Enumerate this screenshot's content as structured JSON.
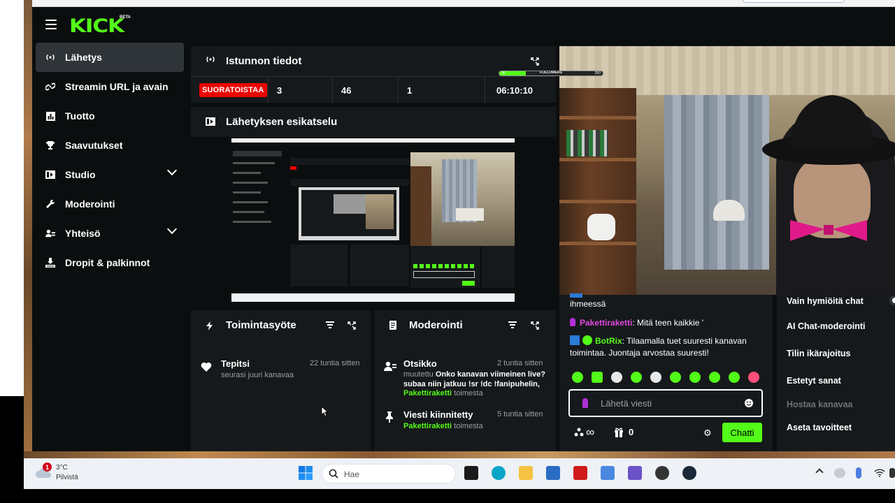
{
  "app": {
    "logo": "KICK",
    "logo_badge": "BETA"
  },
  "sidebar": {
    "items": [
      {
        "label": "Lähetys",
        "icon": "broadcast-icon"
      },
      {
        "label": "Streamin URL ja avain",
        "icon": "link-icon"
      },
      {
        "label": "Tuotto",
        "icon": "chart-icon"
      },
      {
        "label": "Saavutukset",
        "icon": "trophy-icon"
      },
      {
        "label": "Studio",
        "icon": "studio-icon"
      },
      {
        "label": "Moderointi",
        "icon": "wrench-icon"
      },
      {
        "label": "Yhteisö",
        "icon": "community-icon"
      },
      {
        "label": "Dropit & palkinnot",
        "icon": "drops-icon"
      }
    ]
  },
  "session": {
    "title": "Istunnon tiedot",
    "live_badge": "SUORATOISTAA",
    "stat_1": "3",
    "stat_2": "46",
    "stat_3": "1",
    "duration": "06:10:10"
  },
  "preview": {
    "title": "Lähetyksen esikatselu"
  },
  "follow_goal": {
    "label": "FOLLOWERS",
    "current": "66",
    "target": "250",
    "progress": 0.26
  },
  "activity": {
    "title": "Toimintasyöte",
    "items": [
      {
        "name": "Tepitsi",
        "text": "seurasi juuri kanavaa",
        "time": "22 tuntia sitten"
      }
    ]
  },
  "moderation": {
    "title": "Moderointi",
    "items": [
      {
        "title": "Otsikko",
        "time": "2 tuntia sitten",
        "prefix": "muutettu",
        "message": "Onko kanavan viimeinen live? subaa niin jatkuu !sr !dc !fanipuhelin,",
        "user": "Pakettiraketti",
        "suffix": "toimesta"
      },
      {
        "title": "Viesti kiinnitetty",
        "time": "5 tuntia sitten",
        "user": "Pakettiraketti",
        "suffix": "toimesta"
      }
    ]
  },
  "chat": {
    "partial_line": "ihmeessä",
    "messages": [
      {
        "user": "Pakettiraketti",
        "user_color": "#e04be0",
        "text": "Mitä teen kaikkie '"
      },
      {
        "user": "BotRix",
        "user_color": "#53fc18",
        "text": "Tilaamalla tuet suuresti kanavan toimintaa. Juontaja arvostaa suuresti!"
      }
    ],
    "input_placeholder": "Lähetä viesti",
    "viewers": "∞",
    "gifts": "0",
    "send_label": "Chatti"
  },
  "chat_menu": {
    "items": [
      {
        "label": "Vain hymiöitä chat",
        "disabled": false
      },
      {
        "label": "AI Chat-moderointi",
        "disabled": false
      },
      {
        "label": "Tilin ikärajoitus",
        "disabled": false
      },
      {
        "label": "Estetyt sanat",
        "disabled": false
      },
      {
        "label": "Hostaa kanavaa",
        "disabled": true
      },
      {
        "label": "Aseta tavoitteet",
        "disabled": false
      }
    ]
  },
  "taskbar": {
    "weather_badge": "1",
    "weather_temp": "3°C",
    "weather_desc": "Pilvistä",
    "search_placeholder": "Hae"
  },
  "colors": {
    "brand": "#53fc18",
    "live": "#eb0400",
    "panel": "#16191b",
    "background": "#0b0e0f"
  }
}
